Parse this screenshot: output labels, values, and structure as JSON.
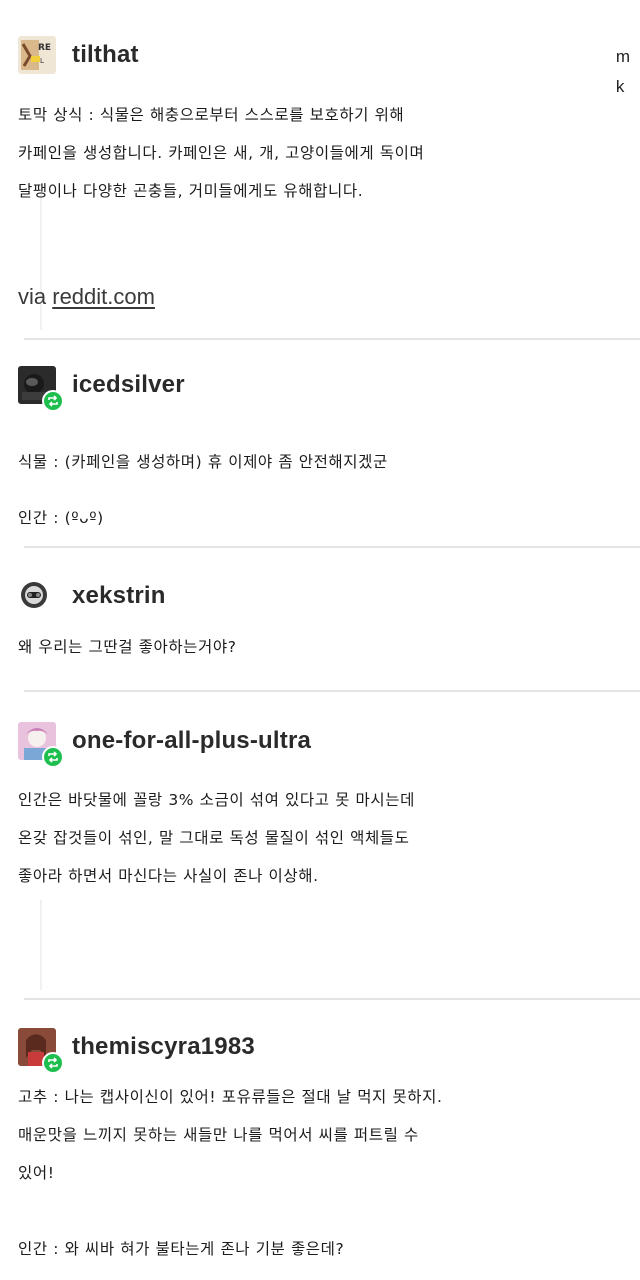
{
  "corner_letters": [
    "m",
    "k"
  ],
  "posts": [
    {
      "username": "tilthat",
      "avatar": "tilthat-avatar",
      "reblog": false,
      "lines": [
        "토막 상식 : 식물은 해충으로부터 스스로를 보호하기 위해",
        "카페인을 생성합니다. 카페인은 새, 개, 고양이들에게 독이며",
        "달팽이나 다양한 곤충들, 거미들에게도 유해합니다."
      ],
      "via_prefix": "via ",
      "via_link": "reddit.com"
    },
    {
      "username": "icedsilver",
      "avatar": "icedsilver-avatar",
      "reblog": true,
      "lines": [
        "식물 : (카페인을 생성하며) 휴 이제야 좀 안전해지겠군",
        "인간 : (ºᴗº)"
      ]
    },
    {
      "username": "xekstrin",
      "avatar": "xekstrin-avatar",
      "reblog": false,
      "lines": [
        "왜 우리는 그딴걸 좋아하는거야?"
      ]
    },
    {
      "username": "one-for-all-plus-ultra",
      "avatar": "one-for-all-avatar",
      "reblog": true,
      "lines": [
        "인간은 바닷물에 꼴랑 3% 소금이 섞여 있다고 못 마시는데",
        "온갖 잡것들이 섞인, 말 그대로 독성 물질이 섞인 액체들도",
        "좋아라 하면서 마신다는 사실이 존나 이상해."
      ]
    },
    {
      "username": "themiscyra1983",
      "avatar": "themiscyra-avatar",
      "reblog": true,
      "lines": [
        "고추 : 나는 캡사이신이 있어! 포유류들은 절대 날 먹지 못하지.",
        "매운맛을 느끼지 못하는 새들만 나를 먹어서 씨를 퍼트릴 수",
        "있어!",
        "",
        "인간 : 와 씨바 혀가 불타는게 존나 기분 좋은데?"
      ]
    }
  ]
}
